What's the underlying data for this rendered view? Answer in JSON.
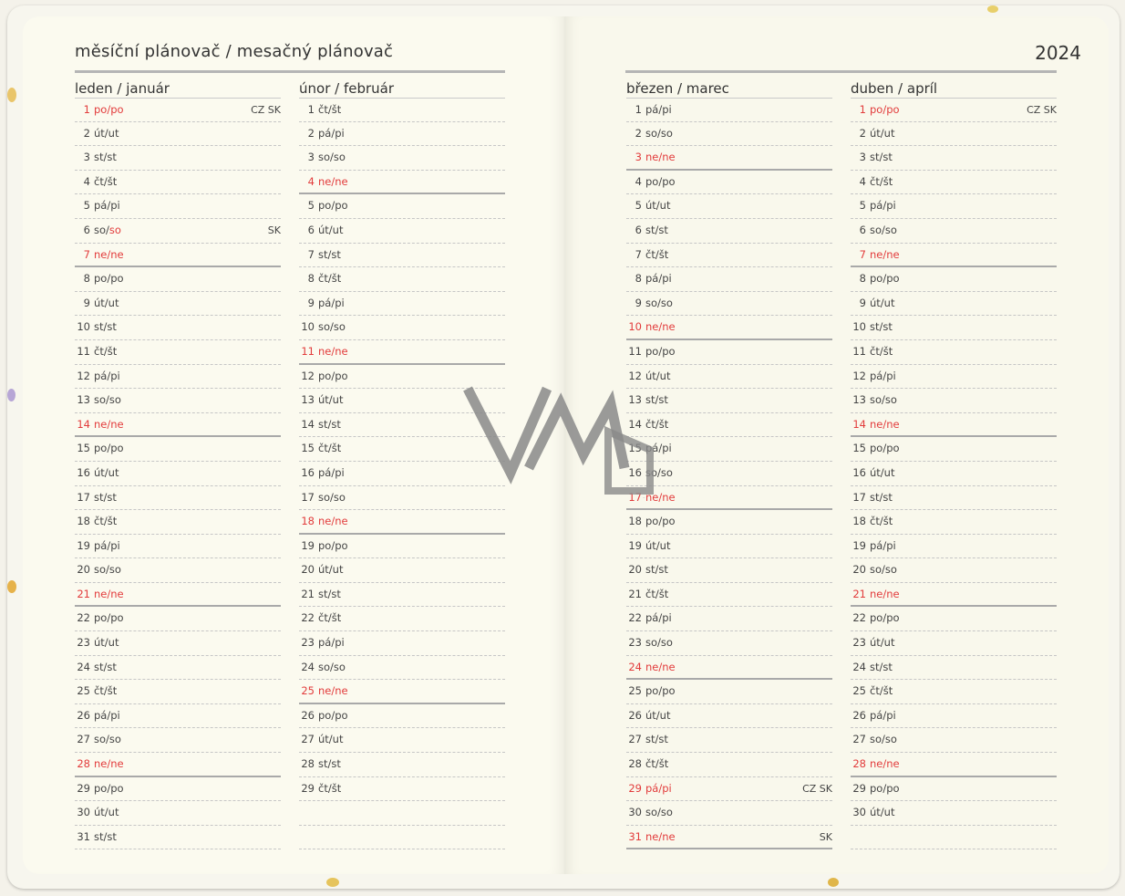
{
  "header": {
    "title": "měsíční plánovač / mesačný plánovač",
    "year": "2024"
  },
  "watermark": "VMD",
  "colors": {
    "weekend_red": "#e23b3b",
    "text": "#444444",
    "paper": "#fbfaef"
  },
  "months": [
    {
      "name": "leden / január",
      "days": [
        {
          "d": "1",
          "w": "po/po",
          "red": true,
          "note": "CZ SK"
        },
        {
          "d": "2",
          "w": "út/ut"
        },
        {
          "d": "3",
          "w": "st/st"
        },
        {
          "d": "4",
          "w": "čt/št"
        },
        {
          "d": "5",
          "w": "pá/pi"
        },
        {
          "d": "6",
          "w": "so/",
          "w2": "so",
          "note": "SK"
        },
        {
          "d": "7",
          "w": "ne/ne",
          "red": true,
          "sun": true
        },
        {
          "d": "8",
          "w": "po/po"
        },
        {
          "d": "9",
          "w": "út/ut"
        },
        {
          "d": "10",
          "w": "st/st"
        },
        {
          "d": "11",
          "w": "čt/št"
        },
        {
          "d": "12",
          "w": "pá/pi"
        },
        {
          "d": "13",
          "w": "so/so"
        },
        {
          "d": "14",
          "w": "ne/ne",
          "red": true,
          "sun": true
        },
        {
          "d": "15",
          "w": "po/po"
        },
        {
          "d": "16",
          "w": "út/ut"
        },
        {
          "d": "17",
          "w": "st/st"
        },
        {
          "d": "18",
          "w": "čt/št"
        },
        {
          "d": "19",
          "w": "pá/pi"
        },
        {
          "d": "20",
          "w": "so/so"
        },
        {
          "d": "21",
          "w": "ne/ne",
          "red": true,
          "sun": true
        },
        {
          "d": "22",
          "w": "po/po"
        },
        {
          "d": "23",
          "w": "út/ut"
        },
        {
          "d": "24",
          "w": "st/st"
        },
        {
          "d": "25",
          "w": "čt/št"
        },
        {
          "d": "26",
          "w": "pá/pi"
        },
        {
          "d": "27",
          "w": "so/so"
        },
        {
          "d": "28",
          "w": "ne/ne",
          "red": true,
          "sun": true
        },
        {
          "d": "29",
          "w": "po/po"
        },
        {
          "d": "30",
          "w": "út/ut"
        },
        {
          "d": "31",
          "w": "st/st"
        }
      ]
    },
    {
      "name": "únor / február",
      "days": [
        {
          "d": "1",
          "w": "čt/št"
        },
        {
          "d": "2",
          "w": "pá/pi"
        },
        {
          "d": "3",
          "w": "so/so"
        },
        {
          "d": "4",
          "w": "ne/ne",
          "red": true,
          "sun": true
        },
        {
          "d": "5",
          "w": "po/po"
        },
        {
          "d": "6",
          "w": "út/ut"
        },
        {
          "d": "7",
          "w": "st/st"
        },
        {
          "d": "8",
          "w": "čt/št"
        },
        {
          "d": "9",
          "w": "pá/pi"
        },
        {
          "d": "10",
          "w": "so/so"
        },
        {
          "d": "11",
          "w": "ne/ne",
          "red": true,
          "sun": true
        },
        {
          "d": "12",
          "w": "po/po"
        },
        {
          "d": "13",
          "w": "út/ut"
        },
        {
          "d": "14",
          "w": "st/st"
        },
        {
          "d": "15",
          "w": "čt/št"
        },
        {
          "d": "16",
          "w": "pá/pi"
        },
        {
          "d": "17",
          "w": "so/so"
        },
        {
          "d": "18",
          "w": "ne/ne",
          "red": true,
          "sun": true
        },
        {
          "d": "19",
          "w": "po/po"
        },
        {
          "d": "20",
          "w": "út/ut"
        },
        {
          "d": "21",
          "w": "st/st"
        },
        {
          "d": "22",
          "w": "čt/št"
        },
        {
          "d": "23",
          "w": "pá/pi"
        },
        {
          "d": "24",
          "w": "so/so"
        },
        {
          "d": "25",
          "w": "ne/ne",
          "red": true,
          "sun": true
        },
        {
          "d": "26",
          "w": "po/po"
        },
        {
          "d": "27",
          "w": "út/ut"
        },
        {
          "d": "28",
          "w": "st/st"
        },
        {
          "d": "29",
          "w": "čt/št"
        }
      ]
    },
    {
      "name": "březen / marec",
      "days": [
        {
          "d": "1",
          "w": "pá/pi"
        },
        {
          "d": "2",
          "w": "so/so"
        },
        {
          "d": "3",
          "w": "ne/ne",
          "red": true,
          "sun": true
        },
        {
          "d": "4",
          "w": "po/po"
        },
        {
          "d": "5",
          "w": "út/ut"
        },
        {
          "d": "6",
          "w": "st/st"
        },
        {
          "d": "7",
          "w": "čt/št"
        },
        {
          "d": "8",
          "w": "pá/pi"
        },
        {
          "d": "9",
          "w": "so/so"
        },
        {
          "d": "10",
          "w": "ne/ne",
          "red": true,
          "sun": true
        },
        {
          "d": "11",
          "w": "po/po"
        },
        {
          "d": "12",
          "w": "út/ut"
        },
        {
          "d": "13",
          "w": "st/st"
        },
        {
          "d": "14",
          "w": "čt/št"
        },
        {
          "d": "15",
          "w": "pá/pi"
        },
        {
          "d": "16",
          "w": "so/so"
        },
        {
          "d": "17",
          "w": "ne/ne",
          "red": true,
          "sun": true
        },
        {
          "d": "18",
          "w": "po/po"
        },
        {
          "d": "19",
          "w": "út/ut"
        },
        {
          "d": "20",
          "w": "st/st"
        },
        {
          "d": "21",
          "w": "čt/št"
        },
        {
          "d": "22",
          "w": "pá/pi"
        },
        {
          "d": "23",
          "w": "so/so"
        },
        {
          "d": "24",
          "w": "ne/ne",
          "red": true,
          "sun": true
        },
        {
          "d": "25",
          "w": "po/po"
        },
        {
          "d": "26",
          "w": "út/ut"
        },
        {
          "d": "27",
          "w": "st/st"
        },
        {
          "d": "28",
          "w": "čt/št"
        },
        {
          "d": "29",
          "w": "pá/pi",
          "red": true,
          "note": "CZ SK"
        },
        {
          "d": "30",
          "w": "so/so"
        },
        {
          "d": "31",
          "w": "ne/ne",
          "red": true,
          "sun": true,
          "note": "SK"
        }
      ]
    },
    {
      "name": "duben / apríl",
      "days": [
        {
          "d": "1",
          "w": "po/po",
          "red": true,
          "note": "CZ SK"
        },
        {
          "d": "2",
          "w": "út/ut"
        },
        {
          "d": "3",
          "w": "st/st"
        },
        {
          "d": "4",
          "w": "čt/št"
        },
        {
          "d": "5",
          "w": "pá/pi"
        },
        {
          "d": "6",
          "w": "so/so"
        },
        {
          "d": "7",
          "w": "ne/ne",
          "red": true,
          "sun": true
        },
        {
          "d": "8",
          "w": "po/po"
        },
        {
          "d": "9",
          "w": "út/ut"
        },
        {
          "d": "10",
          "w": "st/st"
        },
        {
          "d": "11",
          "w": "čt/št"
        },
        {
          "d": "12",
          "w": "pá/pi"
        },
        {
          "d": "13",
          "w": "so/so"
        },
        {
          "d": "14",
          "w": "ne/ne",
          "red": true,
          "sun": true
        },
        {
          "d": "15",
          "w": "po/po"
        },
        {
          "d": "16",
          "w": "út/ut"
        },
        {
          "d": "17",
          "w": "st/st"
        },
        {
          "d": "18",
          "w": "čt/št"
        },
        {
          "d": "19",
          "w": "pá/pi"
        },
        {
          "d": "20",
          "w": "so/so"
        },
        {
          "d": "21",
          "w": "ne/ne",
          "red": true,
          "sun": true
        },
        {
          "d": "22",
          "w": "po/po"
        },
        {
          "d": "23",
          "w": "út/ut"
        },
        {
          "d": "24",
          "w": "st/st"
        },
        {
          "d": "25",
          "w": "čt/št"
        },
        {
          "d": "26",
          "w": "pá/pi"
        },
        {
          "d": "27",
          "w": "so/so"
        },
        {
          "d": "28",
          "w": "ne/ne",
          "red": true,
          "sun": true
        },
        {
          "d": "29",
          "w": "po/po"
        },
        {
          "d": "30",
          "w": "út/ut"
        }
      ]
    }
  ]
}
